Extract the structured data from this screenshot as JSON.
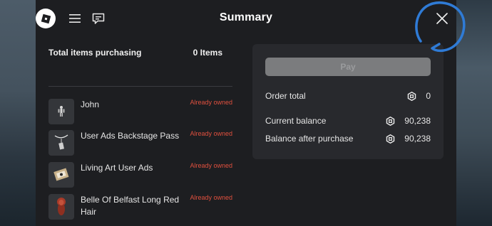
{
  "header": {
    "title": "Summary"
  },
  "summary": {
    "total_label": "Total items purchasing",
    "total_value": "0 Items"
  },
  "items": [
    {
      "name": "John",
      "status": "Already owned"
    },
    {
      "name": "User Ads Backstage Pass",
      "status": "Already owned"
    },
    {
      "name": "Living Art User Ads",
      "status": "Already owned"
    },
    {
      "name": "Belle Of Belfast Long Red Hair",
      "status": "Already owned"
    }
  ],
  "checkout": {
    "pay_label": "Pay",
    "order_total_label": "Order total",
    "order_total_value": "0",
    "current_balance_label": "Current balance",
    "current_balance_value": "90,238",
    "after_label": "Balance after purchase",
    "after_value": "90,238"
  },
  "icons": {
    "logo": "roblox-logo-icon",
    "menu": "hamburger-menu-icon",
    "chat": "chat-icon",
    "close": "close-icon",
    "currency": "robux-icon"
  },
  "colors": {
    "owned": "#e0503e",
    "annotation": "#2f7bd6"
  }
}
